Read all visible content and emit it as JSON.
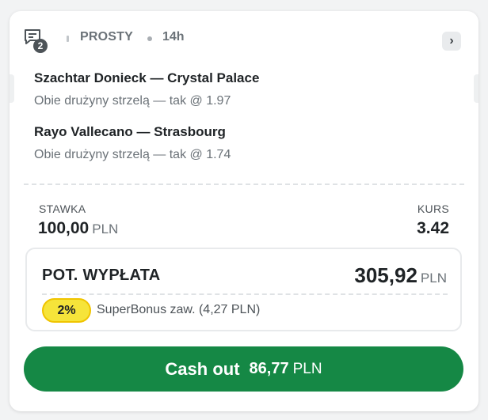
{
  "header": {
    "selection_count": "2",
    "bet_type": "PROSTY",
    "time": "14h",
    "expand_glyph": "›",
    "icons": [
      "bet-slip-icon",
      "chevron-right-icon"
    ]
  },
  "selections": [
    {
      "match": "Szachtar Donieck — Crystal Palace",
      "market": "Obie drużyny strzelą — tak @ 1.97"
    },
    {
      "match": "Rayo Vallecano — Strasbourg",
      "market": "Obie drużyny strzelą — tak @ 1.74"
    }
  ],
  "stake": {
    "label": "STAWKA",
    "amount": "100,00",
    "currency": "PLN"
  },
  "odds": {
    "label": "KURS",
    "value": "3.42"
  },
  "payout": {
    "label": "POT. WYPŁATA",
    "amount": "305,92",
    "currency": "PLN",
    "bonus_badge": "2%",
    "bonus_text": "SuperBonus zaw. (4,27 PLN)"
  },
  "cashout": {
    "label": "Cash out",
    "amount": "86,77",
    "currency": "PLN"
  },
  "colors": {
    "cashout_green": "#158845",
    "bonus_yellow": "#f6e43a",
    "text_dark": "#1f2326",
    "text_muted": "#6b7278"
  }
}
